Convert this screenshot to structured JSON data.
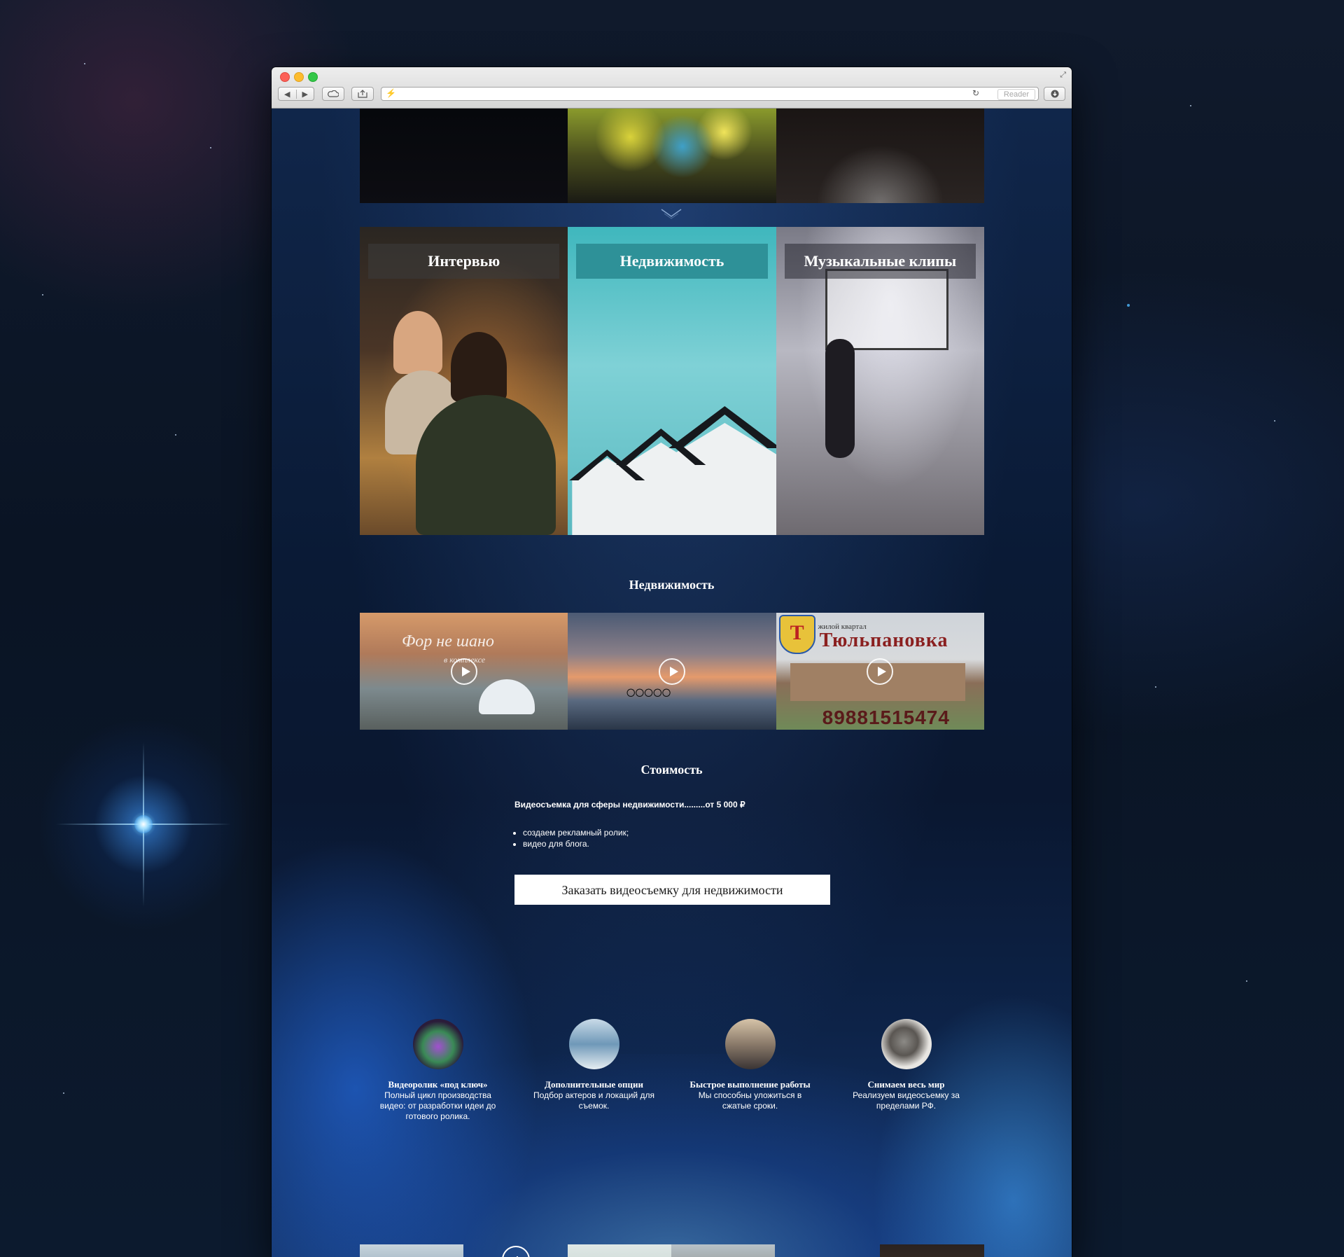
{
  "browser": {
    "reader_label": "Reader"
  },
  "categories": [
    {
      "title": "Интервью"
    },
    {
      "title": "Недвижимость"
    },
    {
      "title": "Музыкальные клипы"
    }
  ],
  "portfolio": {
    "title": "Недвижимость",
    "videos": [
      {
        "overlay_script": "Фор не шано",
        "overlay_sub": "в комплексе"
      },
      {
        "overlay_script": ""
      },
      {
        "overlay_small": "жилой квартал",
        "overlay_title": "Тюльпановка",
        "overlay_phone": "89881515474"
      }
    ]
  },
  "pricing": {
    "title": "Стоимость",
    "price_line": "Видеосъемка для сферы недвижимости.........от 5 000 ₽",
    "items": [
      "создаем рекламный ролик;",
      "видео для блога."
    ],
    "order_button": "Заказать видеосъемку для недвижимости"
  },
  "features": [
    {
      "title": "Видеоролик «под ключ»",
      "text": "Полный цикл производства видео: от разработки идеи до готового ролика."
    },
    {
      "title": "Дополнительные опции",
      "text": "Подбор актеров и локаций для съемок."
    },
    {
      "title": "Быстрое выполнение работы",
      "text": "Мы способны уложиться в сжатые сроки."
    },
    {
      "title": "Снимаем весь мир",
      "text": "Реализуем видеосъемку за пределами РФ."
    }
  ],
  "social": {
    "vk": "vk",
    "facebook": "f",
    "vimeo": "v"
  }
}
